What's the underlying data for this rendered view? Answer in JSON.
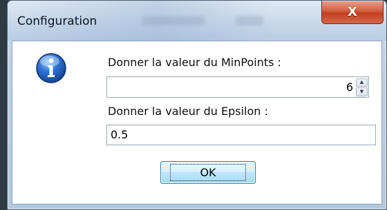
{
  "window": {
    "title": "Configuration",
    "close_glyph": "X"
  },
  "dialog": {
    "icon": "information-icon",
    "minpoints_label": "Donner la valeur du MinPoints :",
    "minpoints_value": "6",
    "spin_up_glyph": "▲",
    "spin_down_glyph": "▼",
    "epsilon_label": "Donner la valeur du Epsilon :",
    "epsilon_value": "0.5",
    "ok_label": "OK"
  },
  "colors": {
    "close_button": "#c2401f",
    "info_icon": "#1f5fb8",
    "ok_button_border": "#3c7fb1"
  }
}
